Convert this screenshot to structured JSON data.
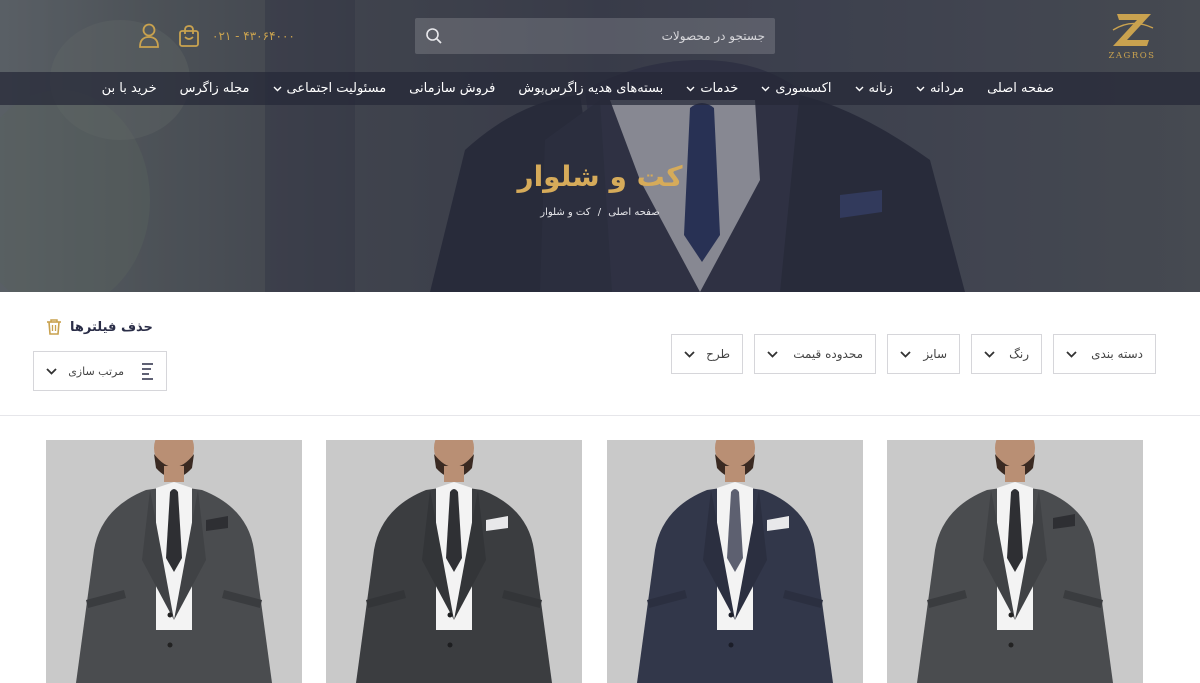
{
  "header": {
    "logo_text": "ZAGROS",
    "search": {
      "placeholder": "جستجو در محصولات"
    },
    "phone": "۰۲۱ - ۴۳۰۶۴۰۰۰",
    "icons": [
      "search-icon",
      "cart-icon",
      "user-icon",
      "logo-icon"
    ]
  },
  "nav": {
    "items": [
      {
        "label": "صفحه اصلی",
        "dropdown": false
      },
      {
        "label": "مردانه",
        "dropdown": true
      },
      {
        "label": "زنانه",
        "dropdown": true
      },
      {
        "label": "اکسسوری",
        "dropdown": true
      },
      {
        "label": "خدمات",
        "dropdown": true
      },
      {
        "label": "بسته‌های هدیه زاگرس‌پوش",
        "dropdown": false
      },
      {
        "label": "فروش سازمانی",
        "dropdown": false
      },
      {
        "label": "مسئولیت اجتماعی",
        "dropdown": true
      },
      {
        "label": "مجله زاگرس",
        "dropdown": false
      },
      {
        "label": "خرید با بن",
        "dropdown": false
      }
    ]
  },
  "hero": {
    "title": "کت و شلوار",
    "breadcrumb": {
      "home": "صفحه اصلی",
      "separator": "/",
      "current": "کت و شلوار"
    }
  },
  "filters": {
    "items": [
      {
        "label": "دسته بندی"
      },
      {
        "label": "رنگ"
      },
      {
        "label": "سایز"
      },
      {
        "label": "محدوده قیمت"
      },
      {
        "label": "طرح"
      }
    ],
    "clear_label": "حذف فیلترها",
    "sort_label": "مرتب سازی"
  },
  "products": [
    {
      "name": "product-1",
      "jacket": "#4a4c4f",
      "tie": "#2e2f33"
    },
    {
      "name": "product-2",
      "jacket": "#3b3d40",
      "tie": "#2f3034"
    },
    {
      "name": "product-3",
      "jacket": "#32374a",
      "tie": "#5d6070"
    },
    {
      "name": "product-4",
      "jacket": "#4a4c4f",
      "tie": "#2e2f33"
    }
  ],
  "colors": {
    "accent_gold": "#c9a24f",
    "title_gold": "#d6ab5a",
    "navy": "#2a2d47"
  }
}
